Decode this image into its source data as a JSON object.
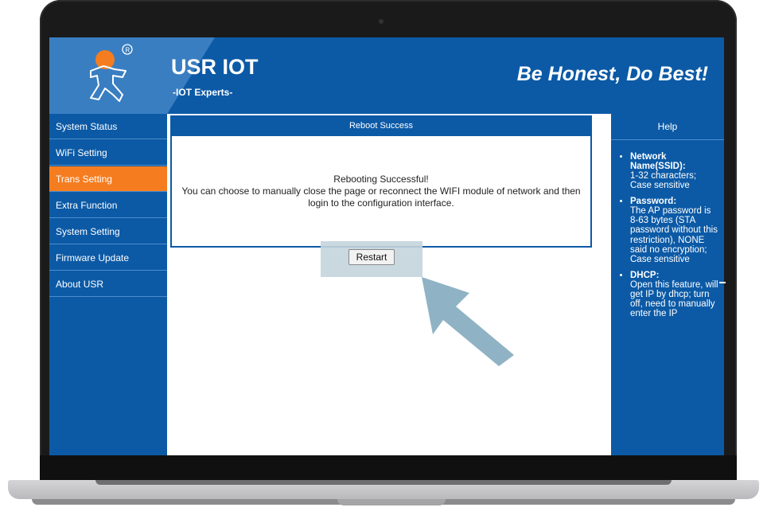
{
  "header": {
    "brand_title": "USR IOT",
    "brand_subtitle": "-IOT Experts-",
    "slogan": "Be Honest, Do Best!"
  },
  "sidebar": {
    "items": [
      {
        "label": "System Status"
      },
      {
        "label": "WiFi Setting"
      },
      {
        "label": "Trans Setting"
      },
      {
        "label": "Extra Function"
      },
      {
        "label": "System Setting"
      },
      {
        "label": "Firmware Update"
      },
      {
        "label": "About USR"
      }
    ],
    "active_item": "Trans Setting"
  },
  "main": {
    "panel_title": "Reboot Success",
    "message_line_1": "Rebooting Successful!",
    "message_line_2": "You can choose to manually close the page or reconnect the WIFI module of network and then",
    "message_line_3": "login to the configuration interface.",
    "restart_label": "Restart"
  },
  "help": {
    "title": "Help",
    "items": [
      {
        "term": "Network Name(SSID):",
        "desc": "1-32 characters; Case sensitive"
      },
      {
        "term": "Password:",
        "desc": "The AP password is 8-63 bytes (STA password without this restriction), NONE said no encryption; Case sensitive"
      },
      {
        "term": "DHCP:",
        "desc": "Open this feature, will get IP by dhcp; turn off, need to manually enter the IP"
      }
    ]
  },
  "colors": {
    "brand_blue": "#0c5aa6",
    "logo_blue": "#3a7ec2",
    "active_orange": "#f57d20",
    "arrow": "#8fb3c4"
  },
  "icons": {
    "logo": "person-logo-icon",
    "registered": "registered-mark-icon",
    "pointer": "pointer-arrow-icon"
  }
}
